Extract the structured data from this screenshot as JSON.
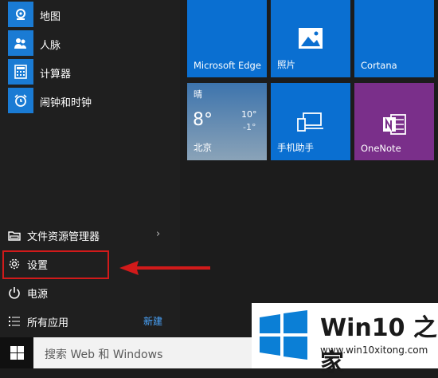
{
  "apps": [
    {
      "label": "地图",
      "icon": "map-icon"
    },
    {
      "label": "人脉",
      "icon": "people-icon"
    },
    {
      "label": "计算器",
      "icon": "calculator-icon"
    },
    {
      "label": "闹钟和时钟",
      "icon": "alarm-clock-icon"
    }
  ],
  "system": {
    "explorer": "文件资源管理器",
    "settings": "设置",
    "power": "电源",
    "all_apps": "所有应用",
    "new_badge": "新建"
  },
  "tiles": {
    "edge": "Microsoft Edge",
    "photos": "照片",
    "cortana": "Cortana",
    "weather": {
      "condition": "晴",
      "temp": "8°",
      "high": "10°",
      "low": "-1°",
      "city": "北京"
    },
    "phone": "手机助手",
    "onenote": "OneNote"
  },
  "taskbar": {
    "search_placeholder": "搜索 Web 和 Windows"
  },
  "watermark": {
    "title": "Win10 之家",
    "url": "www.win10xitong.com"
  },
  "colors": {
    "tile_blue": "#0a6fd1",
    "onenote_purple": "#7a2f8a",
    "highlight_red": "#d11a1a"
  }
}
